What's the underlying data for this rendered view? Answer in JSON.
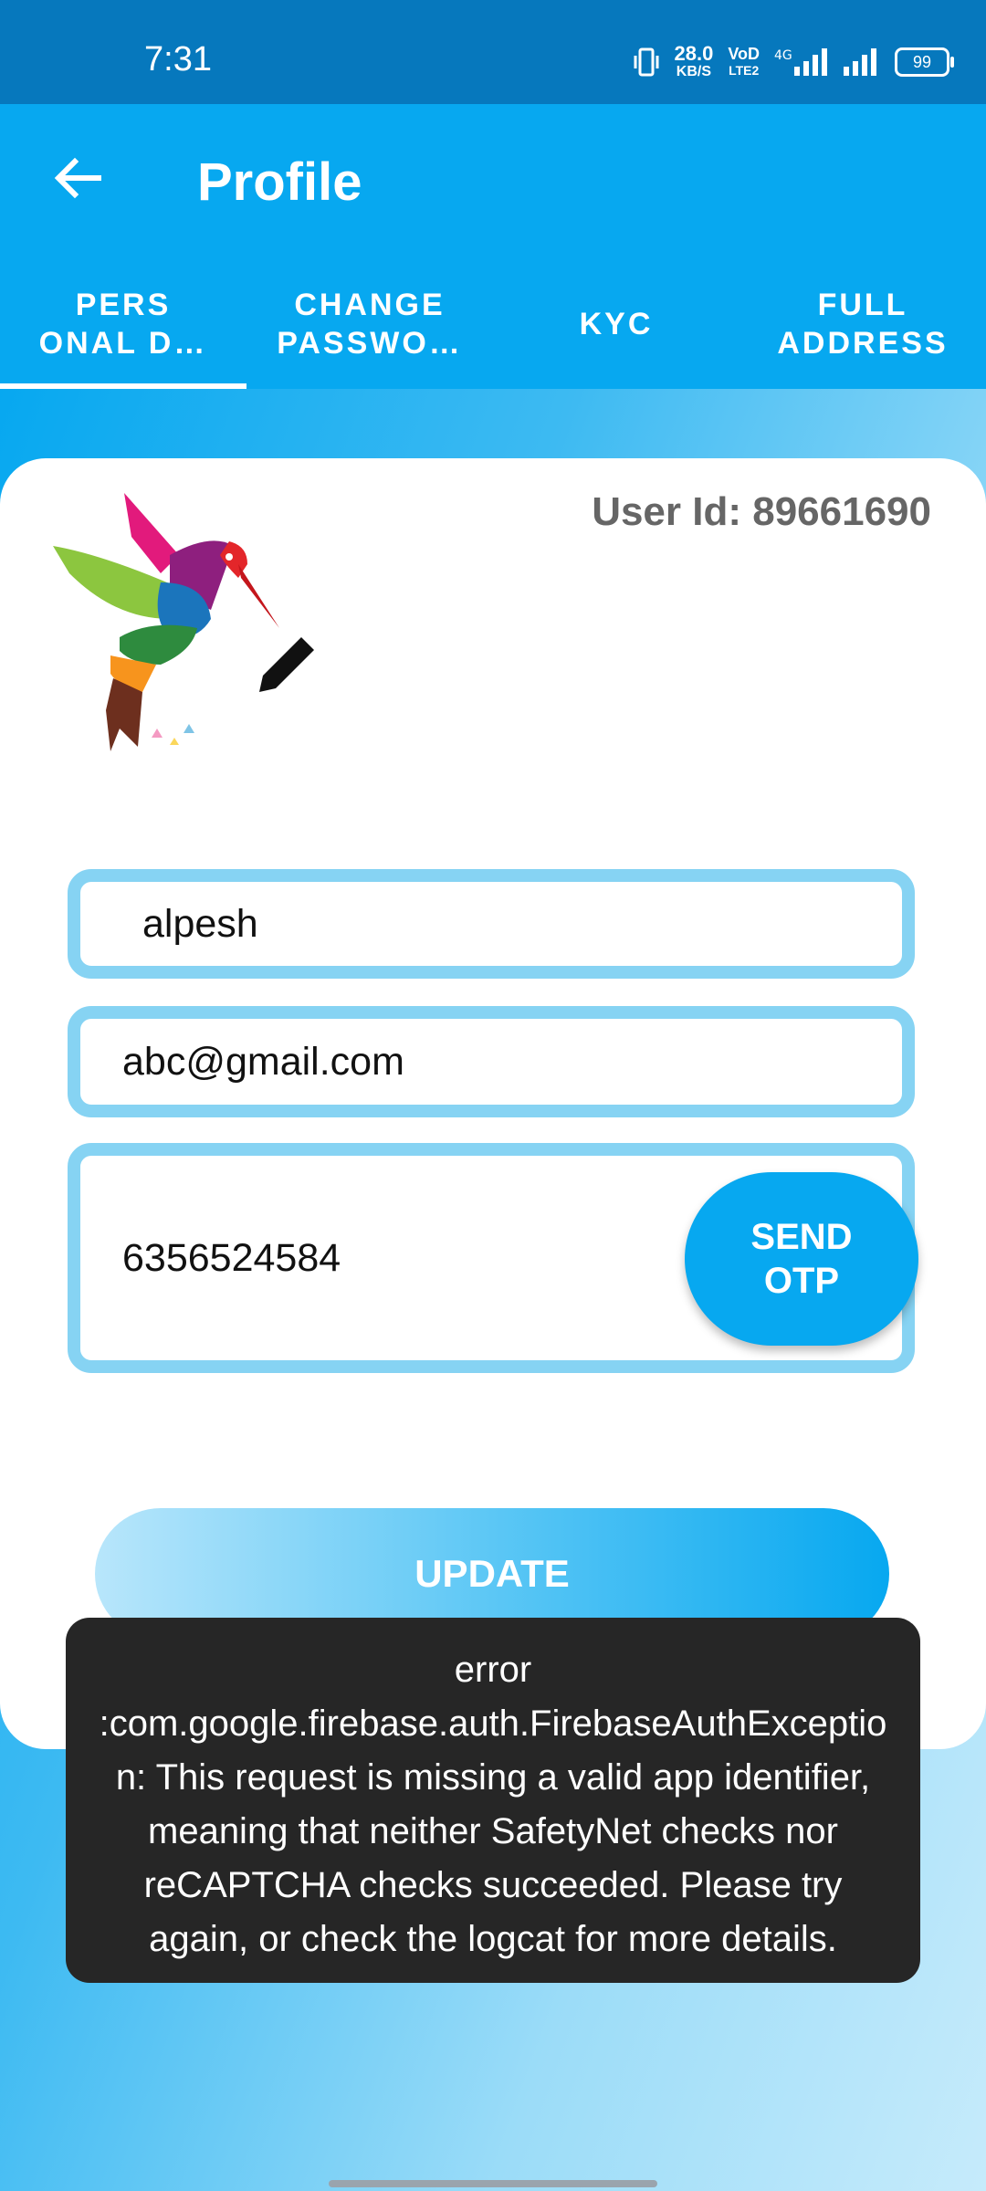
{
  "status_bar": {
    "time": "7:31",
    "speed_value": "28.0",
    "speed_unit": "KB/S",
    "volte_top": "VoD",
    "volte_bottom": "LTE2",
    "network": "4G",
    "battery": "99"
  },
  "app_bar": {
    "title": "Profile",
    "back_icon": "arrow-left-icon"
  },
  "tabs": [
    {
      "label": "PERS\nONAL D…",
      "active": true
    },
    {
      "label": "CHANGE\nPASSWO…",
      "active": false
    },
    {
      "label": "KYC",
      "active": false
    },
    {
      "label": "FULL\nADDRESS",
      "active": false
    }
  ],
  "profile": {
    "user_id_text": "User Id: 89661690",
    "edit_icon": "pencil-icon",
    "logo_icon": "hummingbird-logo-icon"
  },
  "form": {
    "name_value": "alpesh",
    "email_value": "abc@gmail.com",
    "phone_value": "6356524584",
    "send_otp_label": "SEND\nOTP",
    "update_label": "UPDATE"
  },
  "toast": {
    "message": "error :com.google.firebase.auth.FirebaseAuthException: This request is missing a valid app identifier, meaning that neither SafetyNet checks nor reCAPTCHA checks succeeded. Please try again, or check the logcat for more details."
  },
  "colors": {
    "primary": "#07a8f0",
    "status_bar": "#0678bd",
    "field_border": "#86d3f3",
    "toast_bg": "#262626"
  }
}
